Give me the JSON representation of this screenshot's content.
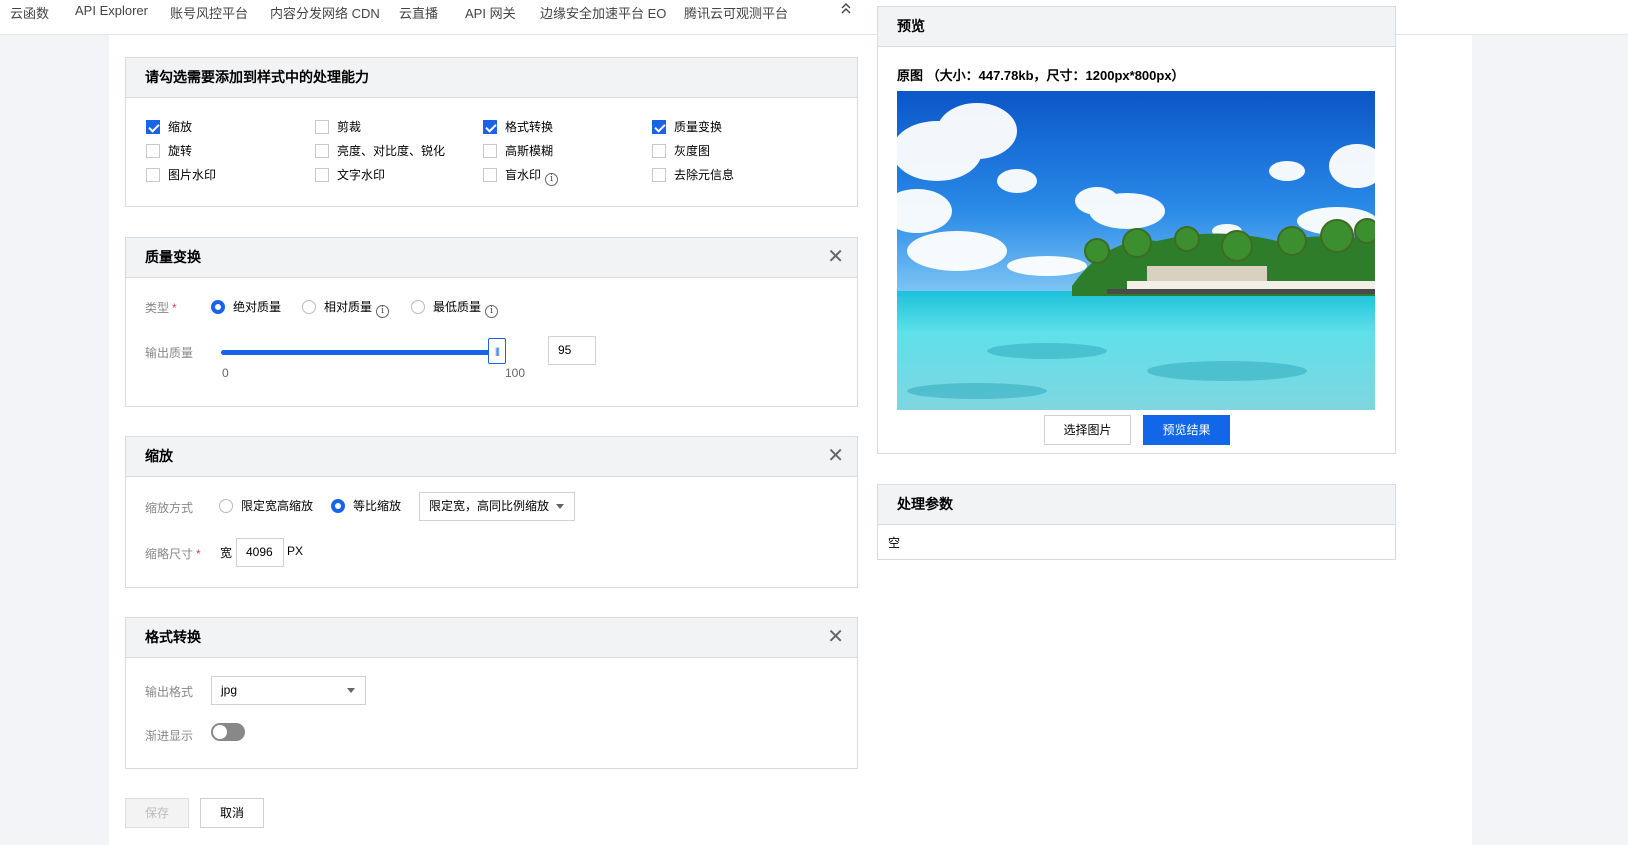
{
  "topnav": {
    "items": [
      "云函数",
      "API Explorer",
      "账号风控平台",
      "内容分发网络 CDN",
      "云直播",
      "API 网关",
      "边缘安全加速平台 EO",
      "腾讯云可观测平台"
    ],
    "collapse_icon": "double-chevron-up-icon"
  },
  "capabilities": {
    "title": "请勾选需要添加到样式中的处理能力",
    "items": [
      {
        "label": "缩放",
        "checked": true
      },
      {
        "label": "剪裁",
        "checked": false
      },
      {
        "label": "格式转换",
        "checked": true
      },
      {
        "label": "质量变换",
        "checked": true
      },
      {
        "label": "旋转",
        "checked": false
      },
      {
        "label": "亮度、对比度、锐化",
        "checked": false
      },
      {
        "label": "高斯模糊",
        "checked": false
      },
      {
        "label": "灰度图",
        "checked": false
      },
      {
        "label": "图片水印",
        "checked": false
      },
      {
        "label": "文字水印",
        "checked": false
      },
      {
        "label": "盲水印",
        "checked": false,
        "info": "i"
      },
      {
        "label": "去除元信息",
        "checked": false
      }
    ]
  },
  "quality": {
    "title": "质量变换",
    "close": "✕",
    "type_label": "类型",
    "required": "*",
    "options": [
      {
        "label": "绝对质量",
        "selected": true
      },
      {
        "label": "相对质量",
        "selected": false,
        "info": "i"
      },
      {
        "label": "最低质量",
        "selected": false,
        "info": "i"
      }
    ],
    "output_label": "输出质量",
    "slider_min": "0",
    "slider_max": "100",
    "slider_value": 0.95,
    "value": "95"
  },
  "scale": {
    "title": "缩放",
    "close": "✕",
    "mode_label": "缩放方式",
    "options": [
      {
        "label": "限定宽高缩放",
        "selected": false
      },
      {
        "label": "等比缩放",
        "selected": true
      }
    ],
    "select_value": "限定宽，高同比例缩放",
    "size_label": "缩略尺寸",
    "required": "*",
    "width_prefix": "宽",
    "width_value": "4096",
    "unit": "PX"
  },
  "format": {
    "title": "格式转换",
    "close": "✕",
    "output_label": "输出格式",
    "output_value": "jpg",
    "progressive_label": "渐进显示",
    "progressive_on": false
  },
  "footer": {
    "save_label": "保存",
    "cancel_label": "取消"
  },
  "preview": {
    "title": "预览",
    "original_info": "原图 （大小：447.78kb，尺寸：1200px*800px）",
    "image_desc": "tropical-beach-image",
    "select_image_label": "选择图片",
    "preview_result_label": "预览结果"
  },
  "params": {
    "title": "处理参数",
    "content": "空"
  },
  "colors": {
    "accent": "#1963e8",
    "primary_button": "#1167e8",
    "required": "#e54545"
  }
}
